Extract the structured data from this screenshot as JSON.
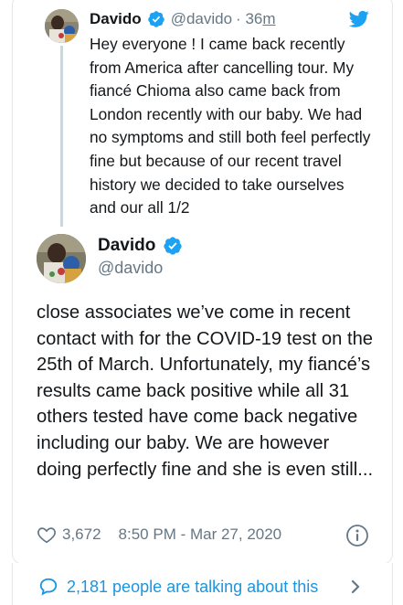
{
  "thread_tweet": {
    "author_name": "Davido",
    "handle": "@davido",
    "separator": "·",
    "time_value": "36",
    "time_unit": "m",
    "text": "Hey everyone ! I came back recently from America after cancelling tour. My fiancé Chioma also came back from London recently with our baby. We had no symptoms and still both feel perfectly fine but because of our recent travel history we decided to take ourselves and our all 1/2"
  },
  "main_tweet": {
    "author_name": "Davido",
    "handle": "@davido",
    "text": "close associates we’ve come in recent contact with for the COVID-19 test on the 25th of March. Unfortunately, my fiancé’s results came back positive while all 31 others tested have come back negative including our baby. We are however doing perfectly fine and she is even still...",
    "like_count": "3,672",
    "timestamp": "8:50 PM - Mar 27, 2020"
  },
  "conversation": {
    "label": "2,181 people are talking about this"
  },
  "icons": {
    "verified": "verified-badge-icon",
    "twitter": "twitter-bird-icon",
    "like": "heart-icon",
    "info": "info-icon",
    "reply": "speech-bubble-icon",
    "chevron": "chevron-right-icon"
  },
  "colors": {
    "twitter_blue": "#1da1f2",
    "link_blue": "#1b95e0",
    "secondary_text": "#657786",
    "primary_text": "#14171a",
    "border": "#e1e8ed"
  }
}
